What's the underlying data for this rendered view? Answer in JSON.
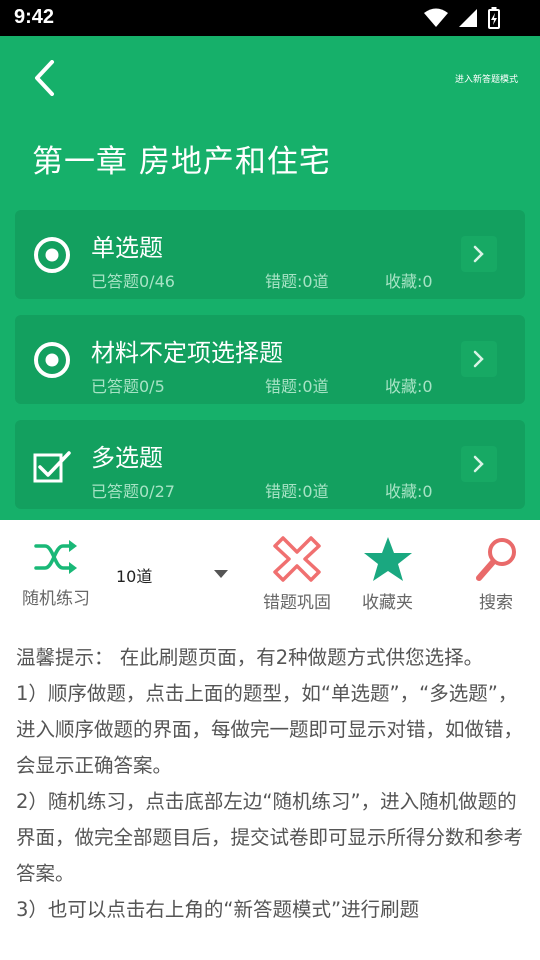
{
  "status_bar": {
    "time": "9:42"
  },
  "header": {
    "mode_link": "进入新答题模式",
    "chapter_title": "第一章 房地产和住宅"
  },
  "cards": [
    {
      "title": "单选题",
      "answered": "已答题0/46",
      "wrong": "错题:0道",
      "favorites": "收藏:0",
      "icon": "radio-target-icon"
    },
    {
      "title": "材料不定项选择题",
      "answered": "已答题0/5",
      "wrong": "错题:0道",
      "favorites": "收藏:0",
      "icon": "radio-target-icon"
    },
    {
      "title": "多选题",
      "answered": "已答题0/27",
      "wrong": "错题:0道",
      "favorites": "收藏:0",
      "icon": "checkbox-check-icon"
    }
  ],
  "toolbar": {
    "random_label": "随机练习",
    "count_value": "10道",
    "wrong_label": "错题巩固",
    "favorites_label": "收藏夹",
    "search_label": "搜索"
  },
  "tips": {
    "line1": "温馨提示： 在此刷题页面，有2种做题方式供您选择。",
    "line2": "1）顺序做题，点击上面的题型，如“单选题”，“多选题”，进入顺序做题的界面，每做完一题即可显示对错，如做错，会显示正确答案。",
    "line3": "2）随机练习，点击底部左边“随机练习”，进入随机做题的界面，做完全部题目后，提交试卷即可显示所得分数和参考答案。",
    "line4": "3）也可以点击右上角的“新答题模式”进行刷题"
  },
  "colors": {
    "primary_green": "#16b06a",
    "card_green": "#13a05f",
    "wrong_red": "#f07070",
    "search_red": "#e96a6a",
    "favorite_teal": "#1aa880",
    "shuffle_green": "#19b877"
  }
}
